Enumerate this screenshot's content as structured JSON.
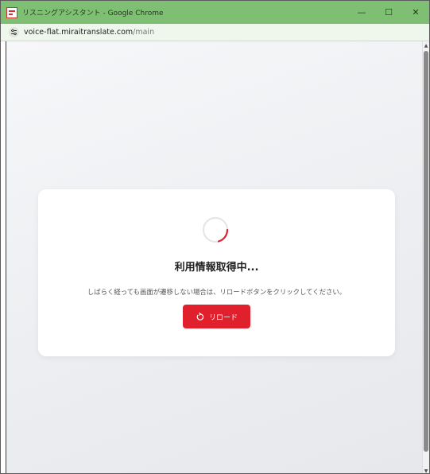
{
  "window": {
    "title": "リスニングアシスタント - Google Chrome",
    "controls": {
      "minimize": "—",
      "maximize": "☐",
      "close": "✕"
    }
  },
  "address_bar": {
    "url_host": "voice-flat.miraitranslate.com",
    "url_path": "/main"
  },
  "main": {
    "loading_title": "利用情報取得中...",
    "message": "しばらく経っても画面が遷移しない場合は、リロードボタンをクリックしてください。",
    "reload_button_label": "リロード"
  },
  "colors": {
    "titlebar": "#7fbf73",
    "accent": "#e0212d",
    "spinner": "#e0212d"
  },
  "icons": {
    "app": "app-icon",
    "site_info": "tune-icon",
    "spinner": "loading-spinner-icon",
    "reload": "reload-icon"
  }
}
